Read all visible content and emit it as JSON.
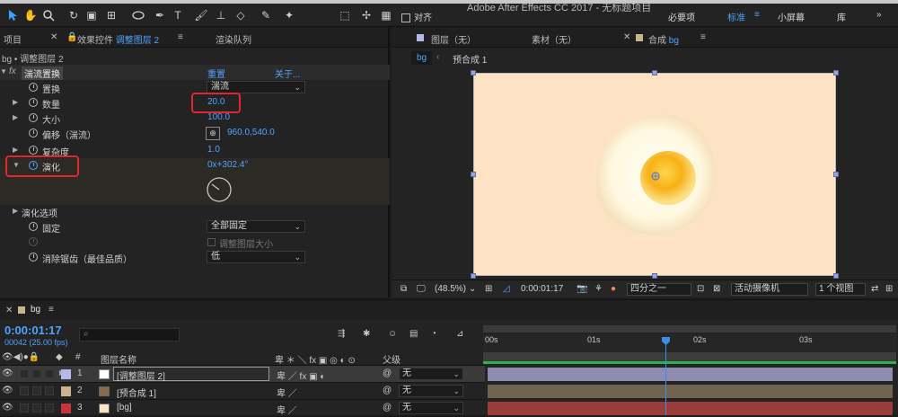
{
  "app": {
    "title": "Adobe After Effects CC 2017 - 无标题项目"
  },
  "toolbar": {
    "snap_label": "对齐",
    "workspaces": [
      "必要项",
      "标准",
      "小屏幕",
      "库"
    ],
    "active_workspace": "标准"
  },
  "left_tabs": {
    "project": "项目",
    "effect_controls_prefix": "效果控件",
    "effect_controls_layer": "调整图层 2",
    "render_queue": "渲染队列"
  },
  "effect_panel": {
    "breadcrumb": "bg • 调整图层 2",
    "fx_icon": "fx",
    "effect_name": "湍流置换",
    "reset": "重置",
    "about": "关于...",
    "properties": [
      {
        "label": "置换",
        "value": "湍流",
        "type": "dropdown"
      },
      {
        "label": "数量",
        "value": "20.0",
        "type": "number"
      },
      {
        "label": "大小",
        "value": "100.0",
        "type": "number"
      },
      {
        "label": "偏移（湍流）",
        "value": "960.0,540.0",
        "type": "point"
      },
      {
        "label": "复杂度",
        "value": "1.0",
        "type": "number"
      },
      {
        "label": "演化",
        "value": "0x+302.4°",
        "type": "angle"
      }
    ],
    "evolution_options": "演化选项",
    "pin": {
      "label": "固定",
      "value": "全部固定"
    },
    "resize_layer": "调整图层大小",
    "antialias": {
      "label": "消除锯齿（最佳品质）",
      "value": "低"
    }
  },
  "comp_tabs": {
    "layer": "图层（无）",
    "footage": "素材（无）",
    "comp_prefix": "合成",
    "comp_name": "bg"
  },
  "comp_breadcrumb": {
    "current": "bg",
    "child": "预合成 1"
  },
  "viewer_bar": {
    "zoom": "(48.5%)",
    "time": "0:00:01:17",
    "resolution": "四分之一",
    "camera": "活动摄像机",
    "views": "1 个视图"
  },
  "timeline": {
    "tab": "bg",
    "timecode": "0:00:01:17",
    "frames": "00042 (25.00 fps)",
    "search_placeholder": "",
    "col_num": "#",
    "col_name": "图层名称",
    "col_parent": "父级",
    "ruler": [
      "00s",
      "01s",
      "02s",
      "03s"
    ],
    "layers": [
      {
        "num": "1",
        "name": "[调整图层 2]",
        "color": "#b8b8e8",
        "parent": "无"
      },
      {
        "num": "2",
        "name": "[预合成 1]",
        "color": "#c9b48e",
        "parent": "无"
      },
      {
        "num": "3",
        "name": "[bg]",
        "color": "#c8343a",
        "parent": "无"
      }
    ]
  },
  "colors": {
    "accent": "#4fa3ff",
    "highlight": "#e0262e"
  }
}
